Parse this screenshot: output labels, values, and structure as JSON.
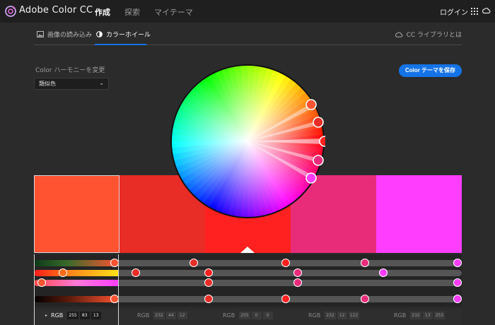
{
  "header": {
    "app_title": "Adobe Color CC",
    "nav": [
      "作成",
      "探索",
      "マイテーマ"
    ],
    "login": "ログイン"
  },
  "tabs": {
    "image_extract": "画像の読み込み",
    "color_wheel": "カラーホイール",
    "cc_library": "CC ライブラリとは"
  },
  "harmony": {
    "label": "Color ハーモニーを変更",
    "selected": "類似色"
  },
  "save_button": "Color テーマを保存",
  "swatches": [
    {
      "color": "#ff5331",
      "rgb": [
        "255",
        "83",
        "13"
      ]
    },
    {
      "color": "#e82c26",
      "rgb": [
        "232",
        "44",
        "12"
      ]
    },
    {
      "color": "#ff2020",
      "rgb": [
        "255",
        "0",
        "0"
      ]
    },
    {
      "color": "#e82c7a",
      "rgb": [
        "232",
        "12",
        "122"
      ]
    },
    {
      "color": "#ff3dff",
      "rgb": [
        "232",
        "13",
        "255"
      ]
    }
  ],
  "value_label": "RGB",
  "colors": {
    "accent": "#1473e6",
    "topbar": "#1f1f1f",
    "background": "#2b2b2b"
  }
}
